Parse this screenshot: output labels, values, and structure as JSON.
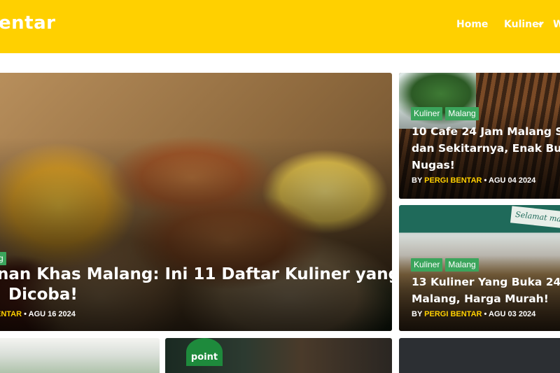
{
  "site": {
    "logo_text": "entar"
  },
  "nav": {
    "items": [
      {
        "label": "Home"
      },
      {
        "label": "Kuliner"
      },
      {
        "label": "W"
      }
    ]
  },
  "colors": {
    "header_bg": "#ffd000",
    "category_bg": "#3ba55c",
    "author": "#ffd000"
  },
  "hero": {
    "category": "g",
    "title_line1": "nan Khas Malang: Ini 11 Daftar Kuliner yang",
    "title_line2": "Dicoba!",
    "meta_author": "ENTAR",
    "meta_date": "• AGU 16 2024"
  },
  "side_posts": [
    {
      "categories": [
        "Kuliner",
        "Malang"
      ],
      "title_line1": "10 Cafe 24 Jam Malang S",
      "title_line2": "dan Sekitarnya, Enak Bu",
      "title_line3": "Nugas!",
      "meta_by": "BY",
      "meta_author": "PERGI BENTAR",
      "meta_date": "• AGU 04 2024"
    },
    {
      "categories": [
        "Kuliner",
        "Malang"
      ],
      "title_line1": "13 Kuliner Yang Buka 24",
      "title_line2": "Malang, Harga Murah!",
      "meta_by": "BY",
      "meta_author": "PERGI BENTAR",
      "meta_date": "• AGU 03 2024",
      "sign_text": "Selamat ma..."
    }
  ],
  "bottom_posts": [
    {
      "logo_text": "point"
    }
  ]
}
